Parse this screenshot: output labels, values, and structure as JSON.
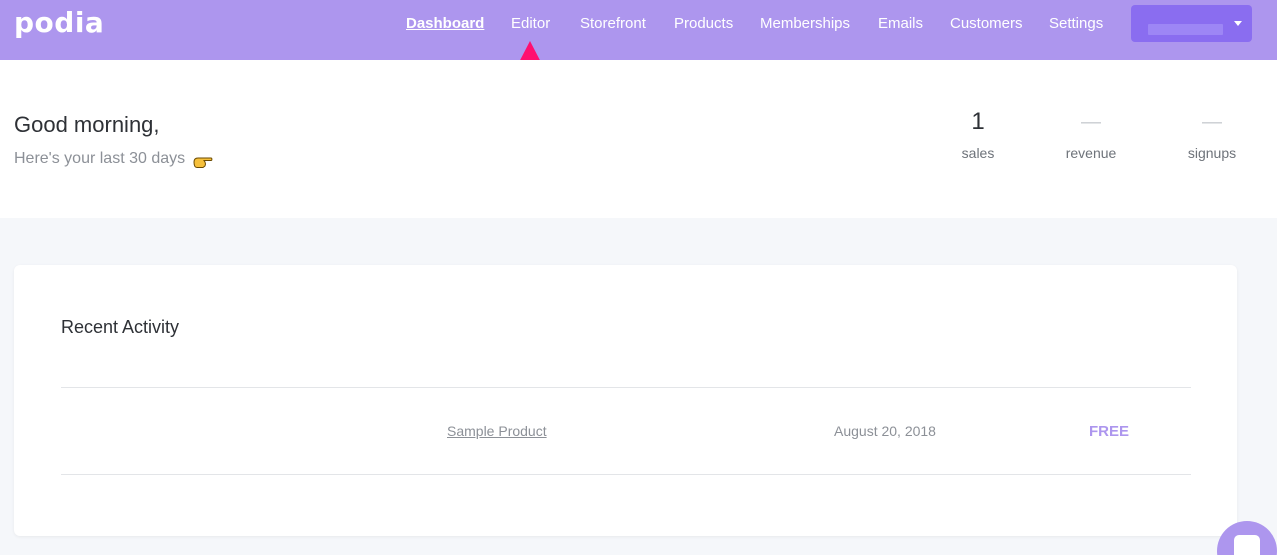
{
  "app": {
    "logo_text": "podia"
  },
  "nav": {
    "items": [
      {
        "label": "Dashboard",
        "active": true
      },
      {
        "label": "Editor",
        "active": false
      },
      {
        "label": "Storefront",
        "active": false
      },
      {
        "label": "Products",
        "active": false
      },
      {
        "label": "Memberships",
        "active": false
      },
      {
        "label": "Emails",
        "active": false
      },
      {
        "label": "Customers",
        "active": false
      },
      {
        "label": "Settings",
        "active": false
      }
    ]
  },
  "account_dropdown": {
    "caret_icon": "caret-down-icon"
  },
  "annotation": {
    "arrow_color": "#ff0f6f",
    "points_to": "Editor"
  },
  "summary": {
    "greeting": "Good morning,",
    "subtitle": "Here's your last 30 days",
    "hand_icon": "pointing-hand-icon",
    "stats": [
      {
        "value": "1",
        "label": "sales"
      },
      {
        "value": "—",
        "label": "revenue"
      },
      {
        "value": "—",
        "label": "signups"
      }
    ]
  },
  "activity": {
    "title": "Recent Activity",
    "rows": [
      {
        "product": "Sample Product",
        "date": "August 20, 2018",
        "price": "FREE"
      }
    ]
  },
  "colors": {
    "brand": "#ad96ee",
    "brand_dark": "#8a6df0",
    "page_bg": "#f5f7fa",
    "price_accent": "#ad96ee"
  },
  "chat": {
    "icon": "chat-icon"
  }
}
